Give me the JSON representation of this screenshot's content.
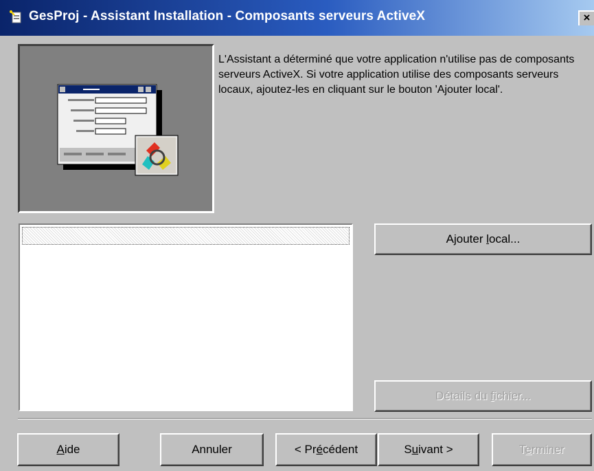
{
  "title": {
    "text": "GesProj - Assistant Installation - Composants serveurs ActiveX",
    "close_label": "×"
  },
  "description": "L'Assistant a déterminé que votre application n'utilise pas de composants serveurs ActiveX. Si votre application utilise des composants serveurs locaux, ajoutez-les en cliquant sur le bouton 'Ajouter local'.",
  "list": {
    "items": []
  },
  "buttons": {
    "add_local": {
      "pre": "Ajouter ",
      "key": "l",
      "post": "ocal..."
    },
    "file_details": {
      "pre": "Détails du ",
      "key": "f",
      "post": "ichier..."
    },
    "help": {
      "pre": "",
      "key": "A",
      "post": "ide"
    },
    "cancel": {
      "pre": "Annuler",
      "key": "",
      "post": ""
    },
    "previous": {
      "pre": "< Pr",
      "key": "é",
      "post": "cédent"
    },
    "next": {
      "pre": "S",
      "key": "u",
      "post": "ivant >"
    },
    "finish": {
      "pre": "T",
      "key": "e",
      "post": "rminer"
    }
  },
  "colors": {
    "title_start": "#0a246a",
    "title_end": "#a6caf0",
    "face": "#c0c0c0"
  }
}
